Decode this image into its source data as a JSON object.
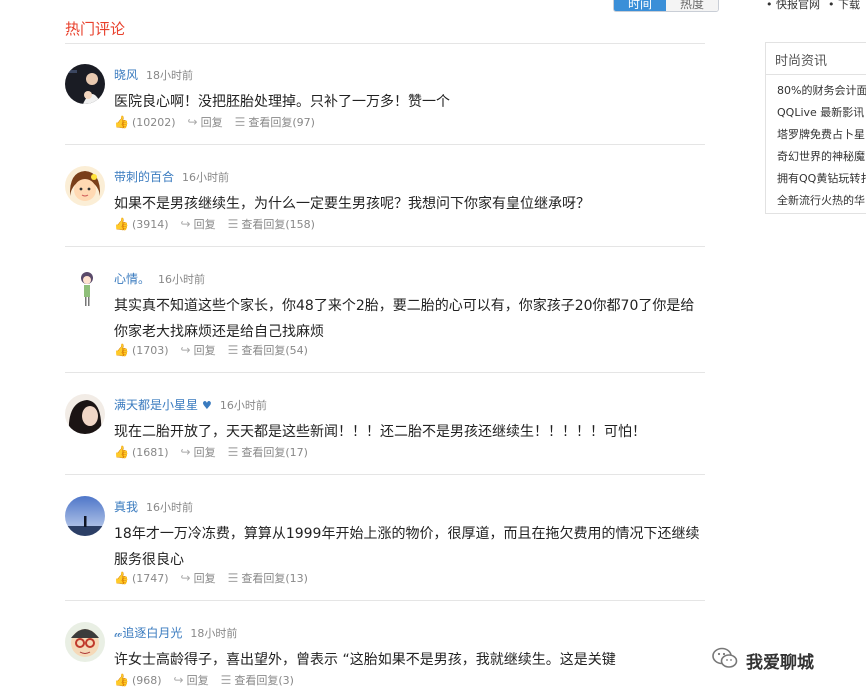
{
  "tabs": [
    "时间",
    "热度"
  ],
  "section_title": "热门评论",
  "top_links": [
    "• 快报官网",
    "• 下载"
  ],
  "sidebar": {
    "title": "时尚资讯",
    "items": [
      "80%的财务会计面",
      "QQLive 最新影讯",
      "塔罗牌免费占卜星",
      "奇幻世界的神秘魔",
      "拥有QQ黄钻玩转扌",
      "全新流行火热的华"
    ]
  },
  "comments": [
    {
      "author": "晓风",
      "time": "18小时前",
      "text": "医院良心啊！没把胚胎处理掉。只补了一万多！赞一个",
      "likes": "(10202)",
      "reply": "回复",
      "view": "查看回复",
      "view_count": "(97)"
    },
    {
      "author": "带刺的百合",
      "time": "16小时前",
      "text": "如果不是男孩继续生，为什么一定要生男孩呢？我想问下你家有皇位继承呀？",
      "likes": "(3914)",
      "reply": "回复",
      "view": "查看回复",
      "view_count": "(158)"
    },
    {
      "author": "心情。",
      "time": "16小时前",
      "text": "其实真不知道这些个家长，你48了来个2胎，要二胎的心可以有，你家孩子20你都70了你是给你家老大找麻烦还是给自己找麻烦",
      "likes": "(1703)",
      "reply": "回复",
      "view": "查看回复",
      "view_count": "(54)"
    },
    {
      "author": "满天都是小星星",
      "time": "16小时前",
      "text": "现在二胎开放了，天天都是这些新闻！！！还二胎不是男孩还继续生！！！！！可怕！",
      "likes": "(1681)",
      "reply": "回复",
      "view": "查看回复",
      "view_count": "(17)"
    },
    {
      "author": "真我",
      "time": "16小时前",
      "text": "18年才一万冷冻费，算算从1999年开始上涨的物价，很厚道，而且在拖欠费用的情况下还继续服务很良心",
      "likes": "(1747)",
      "reply": "回复",
      "view": "查看回复",
      "view_count": "(13)"
    },
    {
      "author": "𝓌追逐白月光",
      "time": "18小时前",
      "text": "许女士高龄得子，喜出望外，曾表示 “这胎如果不是男孩，我就继续生。这是关键",
      "likes": "(968)",
      "reply": "回复",
      "view": "查看回复",
      "view_count": "(3)"
    }
  ],
  "watermark": "我爱聊城"
}
